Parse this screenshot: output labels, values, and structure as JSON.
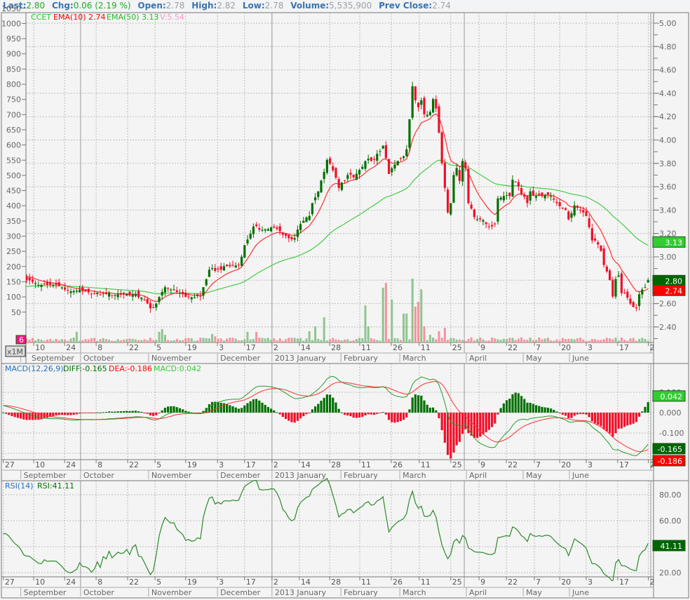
{
  "header": {
    "last_label": "Last:",
    "last": "2.80",
    "chg_label": "Chg:",
    "chg": "0.06 (2.19 %)",
    "open_label": "Open:",
    "open": "2.78",
    "high_label": "High:",
    "high": "2.82",
    "low_label": "Low:",
    "low": "2.78",
    "volume_label": "Volume:",
    "volume": "5,535,900",
    "prev_close_label": "Prev Close:",
    "prev_close": "2.74"
  },
  "legend": {
    "symbol": "CCET",
    "ema10": "EMA(10) 2.74",
    "ema50": "EMA(50) 3.13",
    "vol": "V:5.54",
    "vol_unit_badge": "6",
    "zoom_button": "x1M"
  },
  "macd_legend": {
    "name": "MACD(12,26,9)",
    "diff": "DIFF:-0.165",
    "dea": "DEA:-0.186",
    "macd": "MACD:0.042"
  },
  "rsi_legend": {
    "name": "RSI(14)",
    "rsi": "RSI:41.11"
  },
  "colors": {
    "up": "#007000",
    "down": "#f0102a",
    "vol_up": "#8fc48f",
    "vol_down": "#f4939d",
    "ema10": "#ff3030",
    "ema50": "#44cc44",
    "label_blue": "#3a74b0"
  },
  "chart_data": [
    {
      "type": "candlestick",
      "title": "CCET",
      "price_axis": {
        "ticks": [
          "5.00",
          "4.80",
          "4.60",
          "4.40",
          "4.20",
          "4.00",
          "3.80",
          "3.60",
          "3.40",
          "3.20",
          "3.00",
          "2.80",
          "2.60",
          "2.40"
        ],
        "range": [
          2.27,
          5.09
        ]
      },
      "volume_axis": {
        "ticks": [
          "1050",
          "1000",
          "950",
          "900",
          "850",
          "800",
          "750",
          "700",
          "650",
          "600",
          "550",
          "500",
          "450",
          "400",
          "350",
          "300",
          "250",
          "200",
          "150",
          "100",
          "50"
        ]
      },
      "close_keypoints": [
        [
          -8,
          2.9
        ],
        [
          -4,
          2.86
        ],
        [
          0,
          2.8
        ],
        [
          5,
          2.76
        ],
        [
          10,
          2.76
        ],
        [
          14,
          2.71
        ],
        [
          17,
          2.71
        ],
        [
          22,
          2.68
        ],
        [
          27,
          2.68
        ],
        [
          31,
          2.68
        ],
        [
          36,
          2.68
        ],
        [
          39,
          2.65
        ],
        [
          42,
          2.56
        ],
        [
          44,
          2.6
        ],
        [
          47,
          2.74
        ],
        [
          49,
          2.72
        ],
        [
          52,
          2.69
        ],
        [
          55,
          2.66
        ],
        [
          59,
          2.66
        ],
        [
          60,
          2.74
        ],
        [
          62,
          2.89
        ],
        [
          66,
          2.89
        ],
        [
          68,
          2.92
        ],
        [
          72,
          2.93
        ],
        [
          74,
          3.1
        ],
        [
          77,
          3.26
        ],
        [
          80,
          3.23
        ],
        [
          84,
          3.25
        ],
        [
          86,
          3.22
        ],
        [
          89,
          3.16
        ],
        [
          91,
          3.16
        ],
        [
          93,
          3.28
        ],
        [
          96,
          3.35
        ],
        [
          97,
          3.46
        ],
        [
          99,
          3.56
        ],
        [
          102,
          3.83
        ],
        [
          104,
          3.74
        ],
        [
          106,
          3.59
        ],
        [
          109,
          3.7
        ],
        [
          111,
          3.68
        ],
        [
          114,
          3.77
        ],
        [
          116,
          3.84
        ],
        [
          118,
          3.83
        ],
        [
          121,
          3.95
        ],
        [
          123,
          3.71
        ],
        [
          125,
          3.79
        ],
        [
          128,
          3.86
        ],
        [
          129,
          3.92
        ],
        [
          131,
          4.46
        ],
        [
          132,
          4.34
        ],
        [
          133,
          4.28
        ],
        [
          134,
          4.34
        ],
        [
          135,
          4.22
        ],
        [
          137,
          4.24
        ],
        [
          138,
          4.35
        ],
        [
          139,
          4.27
        ],
        [
          140,
          4.06
        ],
        [
          141,
          3.8
        ],
        [
          142,
          3.59
        ],
        [
          143,
          3.38
        ],
        [
          144,
          3.46
        ],
        [
          145,
          3.7
        ],
        [
          146,
          3.76
        ],
        [
          147,
          3.65
        ],
        [
          148,
          3.82
        ],
        [
          149,
          3.76
        ],
        [
          150,
          3.46
        ],
        [
          152,
          3.34
        ],
        [
          154,
          3.32
        ],
        [
          156,
          3.28
        ],
        [
          158,
          3.26
        ],
        [
          159,
          3.28
        ],
        [
          160,
          3.5
        ],
        [
          162,
          3.52
        ],
        [
          164,
          3.52
        ],
        [
          165,
          3.66
        ],
        [
          166,
          3.64
        ],
        [
          168,
          3.54
        ],
        [
          170,
          3.46
        ],
        [
          171,
          3.56
        ],
        [
          173,
          3.52
        ],
        [
          175,
          3.52
        ],
        [
          178,
          3.52
        ],
        [
          180,
          3.46
        ],
        [
          183,
          3.4
        ],
        [
          184,
          3.32
        ],
        [
          186,
          3.44
        ],
        [
          187,
          3.42
        ],
        [
          190,
          3.35
        ],
        [
          192,
          3.14
        ],
        [
          193,
          3.14
        ],
        [
          195,
          3.05
        ],
        [
          196,
          2.93
        ],
        [
          198,
          2.8
        ],
        [
          199,
          2.66
        ],
        [
          200,
          2.81
        ],
        [
          201,
          2.84
        ],
        [
          202,
          2.69
        ],
        [
          203,
          2.69
        ],
        [
          204,
          2.65
        ],
        [
          205,
          2.6
        ],
        [
          206,
          2.57
        ],
        [
          207,
          2.56
        ],
        [
          208,
          2.68
        ],
        [
          209,
          2.72
        ],
        [
          210,
          2.74
        ],
        [
          211,
          2.8
        ]
      ],
      "last_candle": {
        "open": 2.78,
        "high": 2.82,
        "low": 2.78,
        "close": 2.8
      },
      "volume_keypoints": [
        [
          17,
          35
        ],
        [
          36,
          12
        ],
        [
          45,
          35
        ],
        [
          46,
          44
        ],
        [
          47,
          25
        ],
        [
          61,
          14
        ],
        [
          63,
          28
        ],
        [
          64,
          20
        ],
        [
          75,
          35
        ],
        [
          78,
          35
        ],
        [
          96,
          37
        ],
        [
          98,
          53
        ],
        [
          101,
          83
        ],
        [
          115,
          122
        ],
        [
          116,
          53
        ],
        [
          121,
          180
        ],
        [
          122,
          196
        ],
        [
          124,
          141
        ],
        [
          128,
          95
        ],
        [
          129,
          95
        ],
        [
          131,
          210
        ],
        [
          132,
          118
        ],
        [
          133,
          134
        ],
        [
          134,
          175
        ],
        [
          135,
          53
        ],
        [
          137,
          25
        ],
        [
          140,
          37
        ],
        [
          142,
          48
        ]
      ],
      "ema_start": {
        "ema10": 2.8,
        "ema50": 2.7
      },
      "last_values": {
        "ema10": 2.74,
        "ema50": 3.13,
        "close": 2.8
      }
    },
    {
      "type": "macd",
      "params": [
        12,
        26,
        9
      ],
      "ticks": [
        "0.100",
        "0.000",
        "-0.100"
      ],
      "last_values": {
        "diff": -0.165,
        "dea": -0.186,
        "macd": 0.042
      },
      "box_labels": {
        "diff": "-0.165",
        "dea": "-0.186",
        "macd": "0.042"
      }
    },
    {
      "type": "rsi",
      "period": 14,
      "ticks": [
        "80.00",
        "60.00",
        "20.00"
      ],
      "last_value": 41.11,
      "box_label": "41.11"
    }
  ],
  "time_axis": {
    "day_ticks": [
      [
        "27",
        -7.9
      ],
      [
        "10",
        2.4
      ],
      [
        "24",
        12.9
      ],
      [
        "8",
        23.6
      ],
      [
        "22",
        34.3
      ],
      [
        "5",
        43.6
      ],
      [
        "19",
        54.0
      ],
      [
        "3",
        64.8
      ],
      [
        "17",
        74.0
      ],
      [
        "2",
        83.3
      ],
      [
        "14",
        92.6
      ],
      [
        "28",
        102.9
      ],
      [
        "11",
        113.1
      ],
      [
        "26",
        123.8
      ],
      [
        "11",
        133.3
      ],
      [
        "25",
        144.0
      ],
      [
        "9",
        153.6
      ],
      [
        "22",
        162.9
      ],
      [
        "7",
        172.4
      ],
      [
        "20",
        181.0
      ],
      [
        "3",
        190.0
      ],
      [
        "17",
        200.7
      ],
      [
        "2",
        211.1
      ]
    ],
    "months": [
      [
        "September",
        -2
      ],
      [
        "October",
        18.3
      ],
      [
        "November",
        41.4
      ],
      [
        "December",
        64.8
      ],
      [
        "2013 January",
        83.3
      ],
      [
        "February",
        106.7
      ],
      [
        "March",
        126.7
      ],
      [
        "April",
        149.3
      ],
      [
        "May",
        168.6
      ],
      [
        "June",
        184.3
      ]
    ],
    "quarter_lines": [
      18.3,
      83.3,
      148.6,
      211.9
    ]
  }
}
